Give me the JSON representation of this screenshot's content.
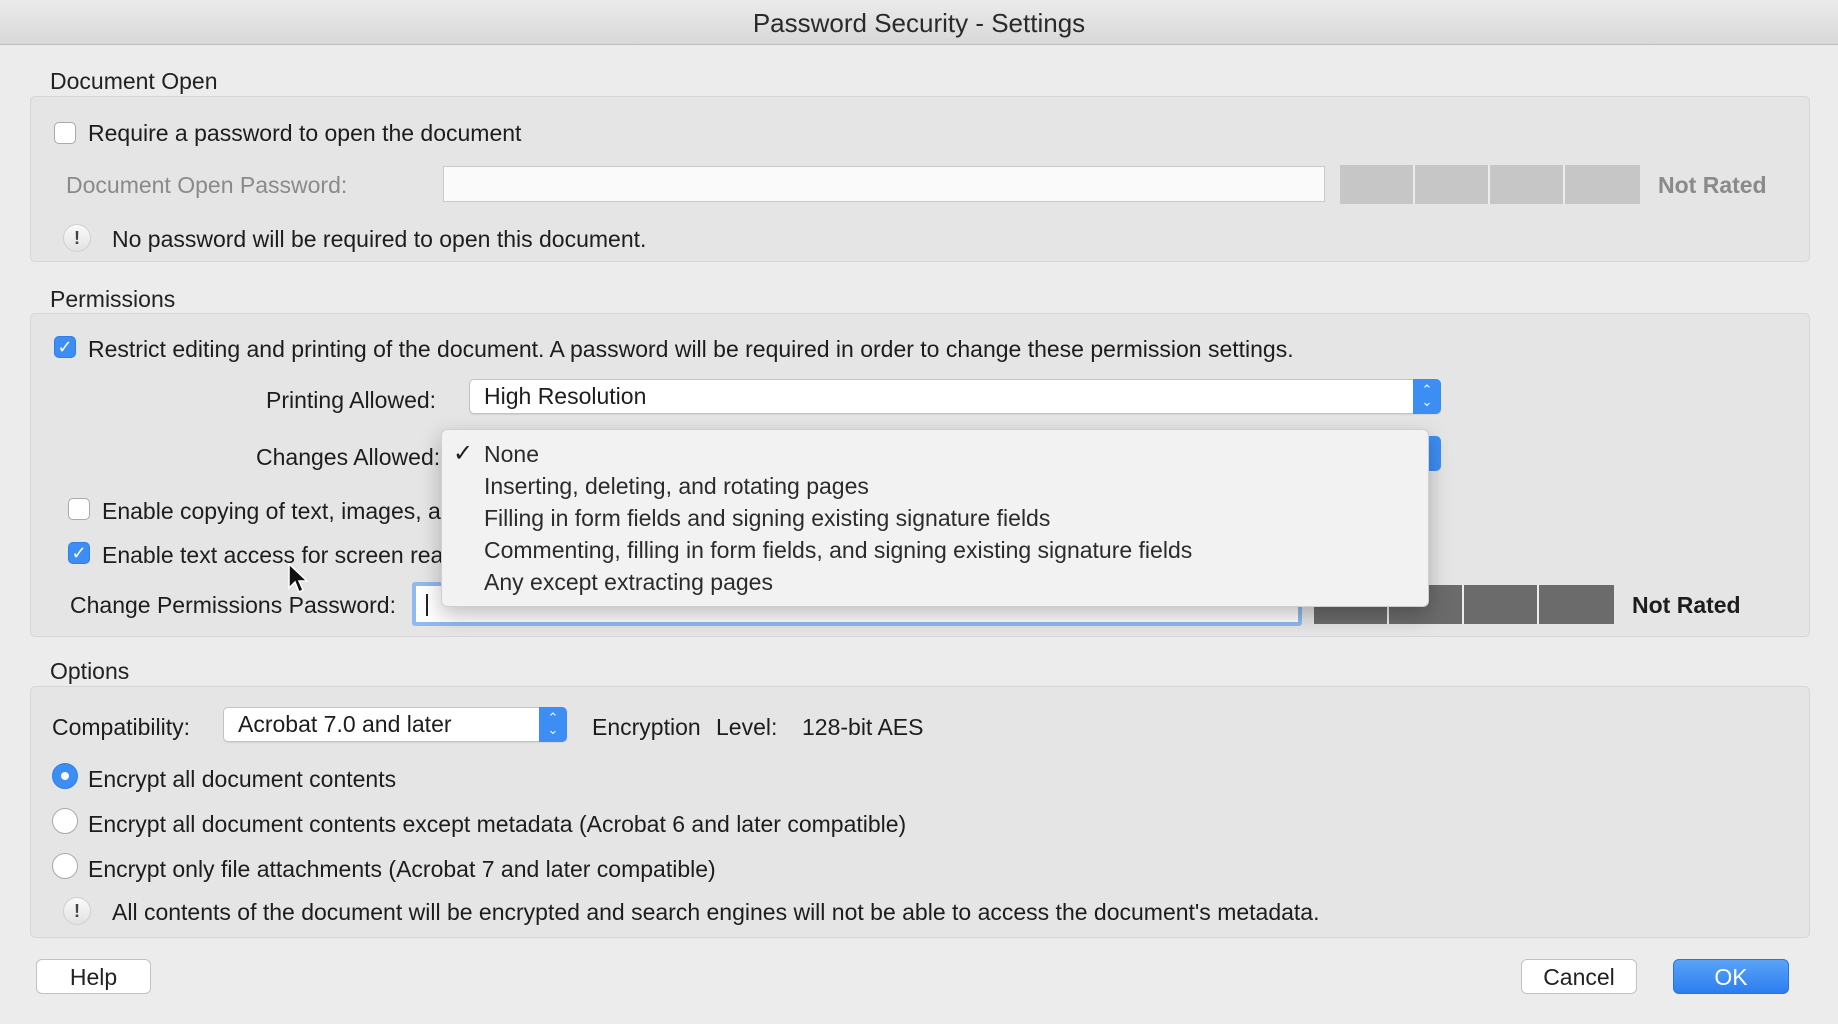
{
  "window": {
    "title": "Password Security - Settings"
  },
  "document_open": {
    "section_label": "Document Open",
    "require_password_label": "Require a password to open the document",
    "require_password_checked": false,
    "password_field_label": "Document Open Password:",
    "password_value": "",
    "strength_rating": "Not Rated",
    "info_text": "No password will be required to open this document."
  },
  "permissions": {
    "section_label": "Permissions",
    "restrict_label": "Restrict editing and printing of the document. A password will be required in order to change these permission settings.",
    "restrict_checked": true,
    "printing_label": "Printing Allowed:",
    "printing_value": "High Resolution",
    "changes_label": "Changes Allowed:",
    "enable_copying_label": "Enable copying of text, images, a",
    "enable_copying_checked": false,
    "enable_screen_reader_label": "Enable text access for screen rea",
    "enable_screen_reader_checked": true,
    "change_password_label": "Change Permissions Password:",
    "change_password_value": "",
    "strength_rating": "Not Rated",
    "changes_menu": {
      "selected": "None",
      "items": [
        "None",
        "Inserting, deleting, and rotating pages",
        "Filling in form fields and signing existing signature fields",
        "Commenting, filling in form fields, and signing existing signature fields",
        "Any except extracting pages"
      ]
    }
  },
  "options": {
    "section_label": "Options",
    "compatibility_label": "Compatibility:",
    "compatibility_value": "Acrobat 7.0 and later",
    "encryption_label_1": "Encryption",
    "encryption_label_2": "Level:",
    "encryption_value": "128-bit AES",
    "radio_all": "Encrypt all document contents",
    "radio_except_metadata": "Encrypt all document contents except metadata (Acrobat 6 and later compatible)",
    "radio_attachments": "Encrypt only file attachments (Acrobat 7 and later compatible)",
    "selected_radio": "radio_all",
    "info_text": "All contents of the document will be encrypted and search engines will not be able to access the document's metadata."
  },
  "buttons": {
    "help": "Help",
    "cancel": "Cancel",
    "ok": "OK"
  },
  "icons": {
    "checkmark": "check-icon",
    "warning": "exclamation-icon",
    "stepper": "up-down-chevron-icon",
    "cursor": "mouse-pointer-icon"
  },
  "colors": {
    "accent": "#3c8ef5",
    "focus_ring": "#8fb9ef"
  }
}
